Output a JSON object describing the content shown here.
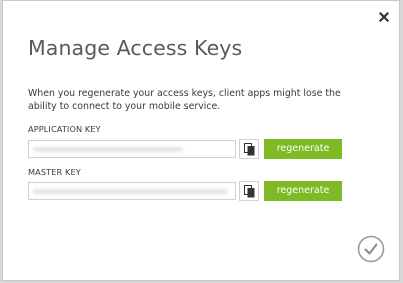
{
  "dialog": {
    "title": "Manage Access Keys",
    "description": "When you regenerate your access keys, client apps might lose the ability to connect to your mobile service.",
    "close_icon": "close-icon",
    "confirm_icon": "checkmark-circle-icon"
  },
  "application_key": {
    "label": "APPLICATION KEY",
    "copy_icon": "copy-icon",
    "regenerate_label": "regenerate"
  },
  "master_key": {
    "label": "MASTER KEY",
    "copy_icon": "copy-icon",
    "regenerate_label": "regenerate"
  },
  "colors": {
    "accent": "#7dba24",
    "title": "#5a5a5a",
    "text": "#3a3a3a"
  }
}
